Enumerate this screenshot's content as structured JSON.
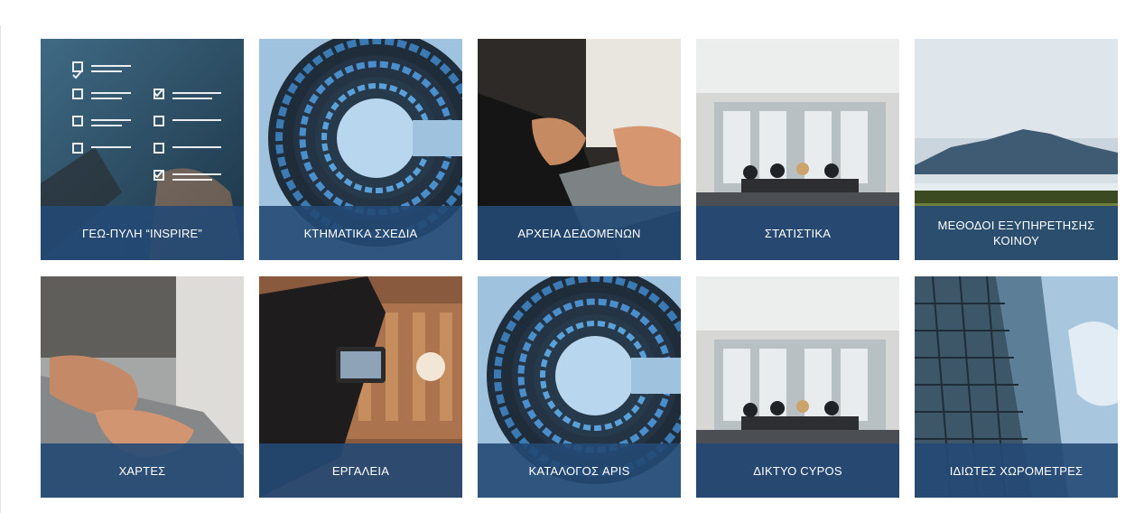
{
  "colors": {
    "caption_bg": "#234974",
    "page_bg": "#ffffff"
  },
  "tiles": [
    {
      "label": "ΓΕΩ-ΠΥΛΗ “INSPIRE”",
      "icon": "checklist-image"
    },
    {
      "label": "ΚΤΗΜΑΤΙΚΑ ΣΧΕΔΙΑ",
      "icon": "circular-building-image"
    },
    {
      "label": "ΑΡΧΕΙΑ ΔΕΔΟΜΕΝΩΝ",
      "icon": "laptop-typing-image"
    },
    {
      "label": "ΣΤΑΤΙΣΤΙΚΑ",
      "icon": "meeting-room-image"
    },
    {
      "label": "ΜΕΘΟΔΟΙ ΕΞΥΠΗΡΕΤΗΣΗΣ ΚΟΙΝΟΥ",
      "icon": "mountain-landscape-image"
    },
    {
      "label": "ΧΑΡΤΕΣ",
      "icon": "laptop-typing-image"
    },
    {
      "label": "ΕΡΓΑΛΕΙΑ",
      "icon": "video-camera-image"
    },
    {
      "label": "ΚΑΤΑΛΟΓΟΣ APIS",
      "icon": "circular-building-image"
    },
    {
      "label": "ΔΙΚΤΥΟ CYPOS",
      "icon": "meeting-room-image"
    },
    {
      "label": "ΙΔΙΩΤΕΣ ΧΩΡΟΜΕΤΡΕΣ",
      "icon": "glass-skyscraper-image"
    }
  ]
}
